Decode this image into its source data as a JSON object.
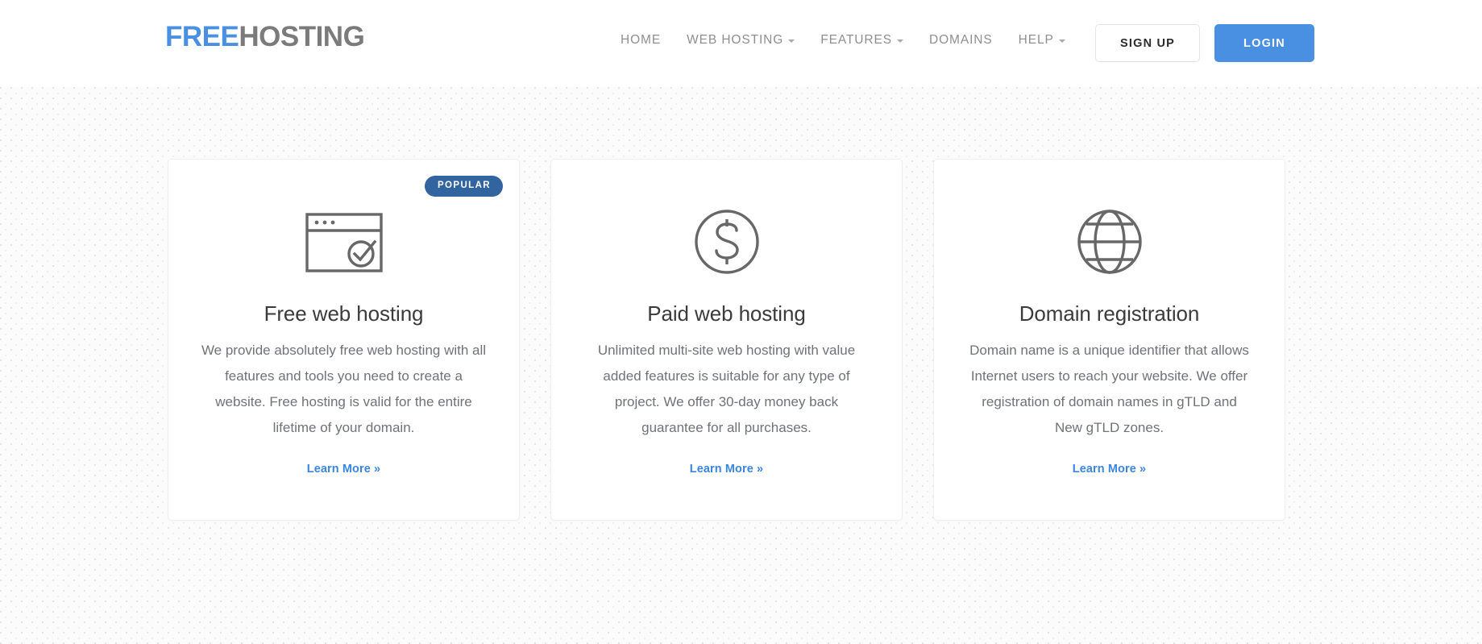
{
  "header": {
    "logo": {
      "primary": "FREE",
      "secondary": "HOSTING",
      "primary_color": "#4a90e2",
      "secondary_color": "#7b7b7b"
    },
    "nav": [
      {
        "label": "HOME",
        "has_dropdown": false
      },
      {
        "label": "WEB HOSTING",
        "has_dropdown": true
      },
      {
        "label": "FEATURES",
        "has_dropdown": true
      },
      {
        "label": "DOMAINS",
        "has_dropdown": false
      },
      {
        "label": "HELP",
        "has_dropdown": true
      }
    ],
    "signup_label": "SIGN UP",
    "login_label": "LOGIN",
    "login_color": "#4a90e2"
  },
  "cards": [
    {
      "badge": "POPULAR",
      "badge_color": "#32659f",
      "icon": "browser-check-icon",
      "title": "Free web hosting",
      "text": "We provide absolutely free web hosting with all features and tools you need to create a website. Free hosting is valid for the entire lifetime of your domain.",
      "link": "Learn More »"
    },
    {
      "badge": null,
      "icon": "dollar-circle-icon",
      "title": "Paid web hosting",
      "text": "Unlimited multi-site web hosting with value added features is suitable for any type of project. We offer 30-day money back guarantee for all purchases.",
      "link": "Learn More »"
    },
    {
      "badge": null,
      "icon": "globe-icon",
      "title": "Domain registration",
      "text": "Domain name is a unique identifier that allows Internet users to reach your website. We offer registration of domain names in gTLD and New gTLD zones.",
      "link": "Learn More »"
    }
  ]
}
